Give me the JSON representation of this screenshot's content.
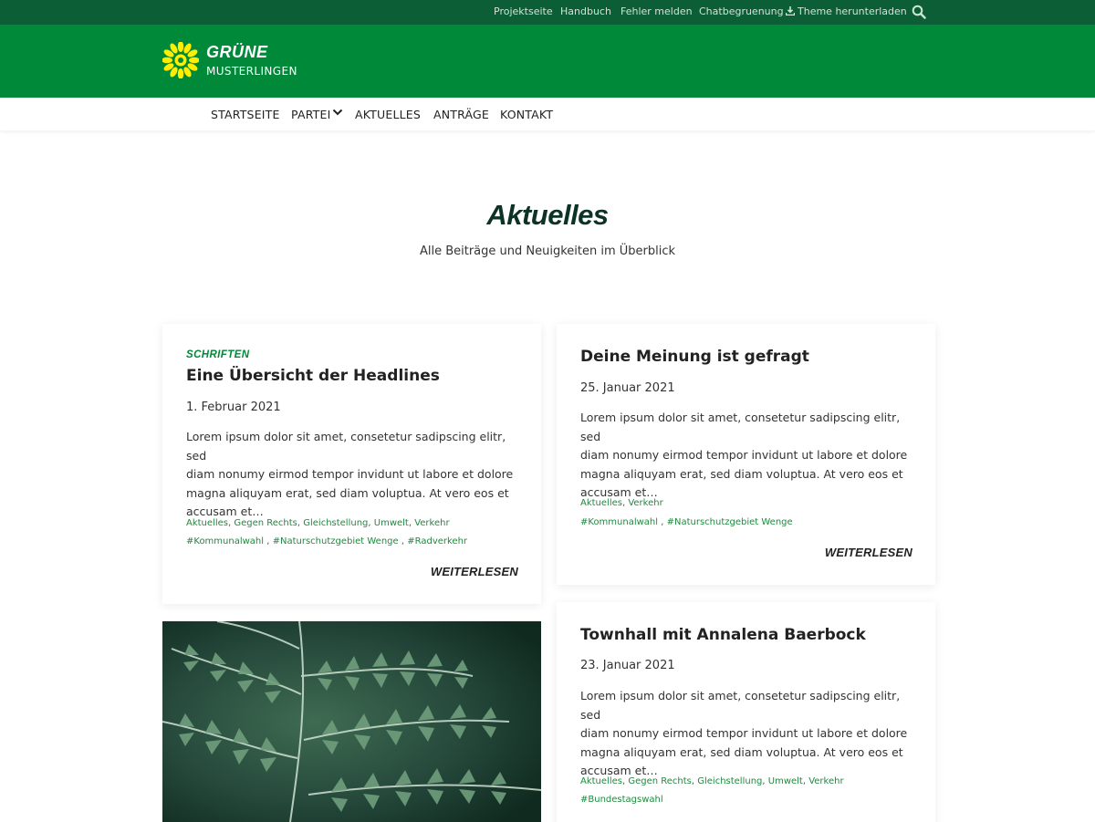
{
  "topbar": {
    "links": [
      "Projektseite",
      "Handbuch",
      "Fehler melden",
      "Chatbegruenung",
      "Theme herunterladen"
    ]
  },
  "brand": {
    "name": "GRÜNE",
    "subtitle": "MUSTERLINGEN"
  },
  "nav": {
    "items": [
      "STARTSEITE",
      "PARTEI",
      "AKTUELLES",
      "ANTRÄGE",
      "KONTAKT"
    ]
  },
  "intro": {
    "title": "Aktuelles",
    "subtitle": "Alle Beiträge und Neuigkeiten im Überblick"
  },
  "posts": [
    {
      "category": "SCHRIFTEN",
      "title": "Eine Übersicht der Headlines",
      "date": "1. Februar 2021",
      "excerpt": [
        "Lorem ipsum dolor sit amet, consetetur sadipscing elitr, sed",
        "diam nonumy eirmod tempor invidunt ut labore et dolore",
        "magna aliquyam erat, sed diam voluptua. At vero eos et",
        "accusam et…"
      ],
      "categories": [
        "Aktuelles",
        "Gegen Rechts",
        "Gleichstellung",
        "Umwelt",
        "Verkehr"
      ],
      "tags": [
        "#Kommunalwahl",
        "#Naturschutzgebiet Wenge",
        "#Radverkehr"
      ],
      "more": "WEITERLESEN"
    },
    {
      "title": "Deine Meinung ist gefragt",
      "date": "25. Januar 2021",
      "excerpt": [
        "Lorem ipsum dolor sit amet, consetetur sadipscing elitr, sed",
        "diam nonumy eirmod tempor invidunt ut labore et dolore",
        "magna aliquyam erat, sed diam voluptua. At vero eos et",
        "accusam et…"
      ],
      "categories": [
        "Aktuelles",
        "Verkehr"
      ],
      "tags": [
        "#Kommunalwahl",
        "#Naturschutzgebiet Wenge"
      ],
      "more": "WEITERLESEN"
    },
    {
      "title": "Townhall mit Annalena Baerbock",
      "date": "23. Januar 2021",
      "excerpt": [
        "Lorem ipsum dolor sit amet, consetetur sadipscing elitr, sed",
        "diam nonumy eirmod tempor invidunt ut labore et dolore",
        "magna aliquyam erat, sed diam voluptua. At vero eos et",
        "accusam et…"
      ],
      "categories": [
        "Aktuelles",
        "Gegen Rechts",
        "Gleichstellung",
        "Umwelt",
        "Verkehr"
      ],
      "tags": [
        "#Bundestagswahl"
      ]
    }
  ],
  "colors": {
    "topbar": "#0b5e35",
    "header": "#008939",
    "accent": "#1f8a3e",
    "sunflower": "#ffee00"
  },
  "icons": [
    "sunflower-logo-icon",
    "download-icon",
    "search-icon",
    "chevron-down-icon"
  ]
}
